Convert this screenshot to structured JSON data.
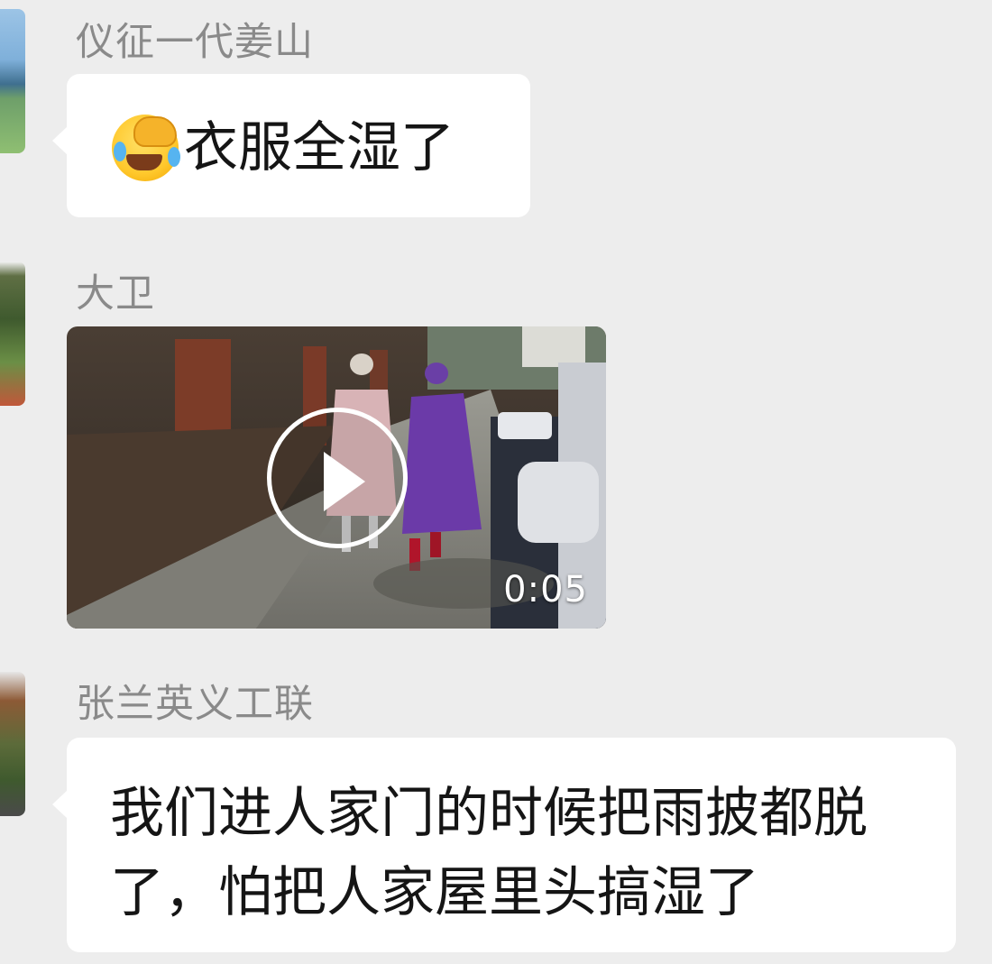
{
  "messages": [
    {
      "sender": "仪征一代姜山",
      "type": "text",
      "emoji": "face-with-tears-and-hand-icon",
      "text": "衣服全湿了"
    },
    {
      "sender": "大卫",
      "type": "video",
      "duration": "0:05"
    },
    {
      "sender": "张兰英义工联",
      "type": "text",
      "text": "我们进人家门的时候把雨披都脱了，怕把人家屋里头搞湿了"
    }
  ],
  "colors": {
    "background": "#ededed",
    "bubble": "#ffffff",
    "sender_name": "#8a8a8a",
    "message_text": "#151515"
  }
}
